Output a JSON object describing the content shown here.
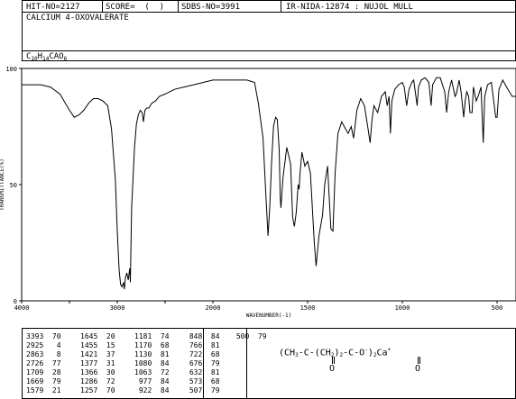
{
  "header": {
    "hit_no": "HIT-NO=2127",
    "score": "SCORE=  (  )",
    "sdbs_no": "SDBS-NO=3991",
    "ir_info": "IR-NIDA-12874 : NUJOL MULL",
    "compound_name": "CALCIUM 4-OXOVALERATE",
    "formula_parts": [
      "C",
      "10",
      "H",
      "14",
      "CAO",
      "6"
    ]
  },
  "chart_data": {
    "type": "line",
    "title": "",
    "xlabel": "WAVENUMBER(-1)",
    "ylabel": "TRANSMITTANCE(%)",
    "xlim": [
      4000,
      400
    ],
    "ylim": [
      0,
      100
    ],
    "x_ticks": [
      "4000",
      "3000",
      "2000",
      "1500",
      "1000",
      "500"
    ],
    "y_ticks": [
      "100",
      "50",
      "0"
    ],
    "series": [
      {
        "name": "",
        "points": [
          [
            4000,
            93
          ],
          [
            3800,
            93
          ],
          [
            3700,
            92
          ],
          [
            3600,
            89
          ],
          [
            3500,
            82
          ],
          [
            3450,
            79
          ],
          [
            3400,
            80
          ],
          [
            3350,
            82
          ],
          [
            3300,
            85
          ],
          [
            3250,
            87
          ],
          [
            3200,
            87
          ],
          [
            3150,
            86
          ],
          [
            3100,
            84
          ],
          [
            3060,
            74
          ],
          [
            3020,
            52
          ],
          [
            3000,
            30
          ],
          [
            2980,
            13
          ],
          [
            2965,
            7
          ],
          [
            2950,
            6
          ],
          [
            2935,
            8
          ],
          [
            2925,
            5
          ],
          [
            2915,
            10
          ],
          [
            2900,
            12
          ],
          [
            2885,
            9
          ],
          [
            2870,
            14
          ],
          [
            2863,
            8
          ],
          [
            2850,
            40
          ],
          [
            2820,
            66
          ],
          [
            2800,
            76
          ],
          [
            2780,
            80
          ],
          [
            2760,
            82
          ],
          [
            2740,
            81
          ],
          [
            2726,
            77
          ],
          [
            2710,
            82
          ],
          [
            2690,
            83
          ],
          [
            2670,
            83
          ],
          [
            2640,
            85
          ],
          [
            2600,
            86
          ],
          [
            2560,
            88
          ],
          [
            2500,
            89
          ],
          [
            2400,
            91
          ],
          [
            2300,
            92
          ],
          [
            2200,
            93
          ],
          [
            2100,
            94
          ],
          [
            2000,
            95
          ],
          [
            1900,
            95
          ],
          [
            1820,
            95
          ],
          [
            1780,
            94
          ],
          [
            1760,
            85
          ],
          [
            1735,
            70
          ],
          [
            1720,
            45
          ],
          [
            1709,
            28
          ],
          [
            1700,
            40
          ],
          [
            1690,
            60
          ],
          [
            1680,
            75
          ],
          [
            1669,
            79
          ],
          [
            1660,
            78
          ],
          [
            1650,
            65
          ],
          [
            1645,
            45
          ],
          [
            1641,
            40
          ],
          [
            1630,
            53
          ],
          [
            1610,
            66
          ],
          [
            1590,
            59
          ],
          [
            1579,
            36
          ],
          [
            1570,
            32
          ],
          [
            1560,
            38
          ],
          [
            1550,
            50
          ],
          [
            1545,
            48
          ],
          [
            1540,
            55
          ],
          [
            1530,
            64
          ],
          [
            1515,
            58
          ],
          [
            1500,
            60
          ],
          [
            1485,
            55
          ],
          [
            1465,
            25
          ],
          [
            1455,
            15
          ],
          [
            1440,
            28
          ],
          [
            1421,
            37
          ],
          [
            1410,
            50
          ],
          [
            1395,
            58
          ],
          [
            1377,
            31
          ],
          [
            1366,
            30
          ],
          [
            1355,
            55
          ],
          [
            1340,
            72
          ],
          [
            1320,
            77
          ],
          [
            1300,
            74
          ],
          [
            1286,
            72
          ],
          [
            1270,
            75
          ],
          [
            1257,
            70
          ],
          [
            1240,
            82
          ],
          [
            1220,
            87
          ],
          [
            1200,
            84
          ],
          [
            1181,
            74
          ],
          [
            1170,
            68
          ],
          [
            1160,
            78
          ],
          [
            1150,
            84
          ],
          [
            1130,
            81
          ],
          [
            1110,
            88
          ],
          [
            1090,
            90
          ],
          [
            1080,
            84
          ],
          [
            1070,
            88
          ],
          [
            1063,
            72
          ],
          [
            1055,
            86
          ],
          [
            1040,
            91
          ],
          [
            1020,
            93
          ],
          [
            1000,
            94
          ],
          [
            990,
            92
          ],
          [
            977,
            84
          ],
          [
            965,
            91
          ],
          [
            950,
            94
          ],
          [
            940,
            95
          ],
          [
            922,
            84
          ],
          [
            915,
            92
          ],
          [
            900,
            95
          ],
          [
            880,
            96
          ],
          [
            860,
            94
          ],
          [
            848,
            84
          ],
          [
            840,
            93
          ],
          [
            820,
            96
          ],
          [
            800,
            96
          ],
          [
            776,
            90
          ],
          [
            766,
            81
          ],
          [
            755,
            90
          ],
          [
            740,
            95
          ],
          [
            722,
            88
          ],
          [
            715,
            89
          ],
          [
            700,
            95
          ],
          [
            690,
            90
          ],
          [
            676,
            79
          ],
          [
            668,
            86
          ],
          [
            660,
            90
          ],
          [
            650,
            88
          ],
          [
            643,
            81
          ],
          [
            632,
            81
          ],
          [
            625,
            92
          ],
          [
            610,
            86
          ],
          [
            600,
            88
          ],
          [
            585,
            92
          ],
          [
            573,
            68
          ],
          [
            565,
            88
          ],
          [
            550,
            93
          ],
          [
            530,
            94
          ],
          [
            507,
            79
          ],
          [
            500,
            79
          ],
          [
            490,
            91
          ],
          [
            470,
            95
          ],
          [
            450,
            92
          ],
          [
            420,
            88
          ],
          [
            400,
            88
          ]
        ]
      }
    ],
    "peaks": [
      {
        "wavenumber": "3393",
        "transmittance": "70"
      },
      {
        "wavenumber": "2925",
        "transmittance": "4"
      },
      {
        "wavenumber": "2863",
        "transmittance": "8"
      },
      {
        "wavenumber": "2726",
        "transmittance": "77"
      },
      {
        "wavenumber": "1709",
        "transmittance": "28"
      },
      {
        "wavenumber": "1669",
        "transmittance": "79"
      },
      {
        "wavenumber": "1579",
        "transmittance": "21"
      },
      {
        "wavenumber": "1645",
        "transmittance": "20"
      },
      {
        "wavenumber": "1455",
        "transmittance": "15"
      },
      {
        "wavenumber": "1421",
        "transmittance": "37"
      },
      {
        "wavenumber": "1377",
        "transmittance": "31"
      },
      {
        "wavenumber": "1366",
        "transmittance": "30"
      },
      {
        "wavenumber": "1286",
        "transmittance": "72"
      },
      {
        "wavenumber": "1257",
        "transmittance": "70"
      },
      {
        "wavenumber": "1181",
        "transmittance": "74"
      },
      {
        "wavenumber": "1170",
        "transmittance": "68"
      },
      {
        "wavenumber": "1130",
        "transmittance": "81"
      },
      {
        "wavenumber": "1080",
        "transmittance": "84"
      },
      {
        "wavenumber": "1063",
        "transmittance": "72"
      },
      {
        "wavenumber": "977",
        "transmittance": "84"
      },
      {
        "wavenumber": "922",
        "transmittance": "84"
      },
      {
        "wavenumber": "848",
        "transmittance": "84"
      },
      {
        "wavenumber": "766",
        "transmittance": "81"
      },
      {
        "wavenumber": "722",
        "transmittance": "68"
      },
      {
        "wavenumber": "676",
        "transmittance": "79"
      },
      {
        "wavenumber": "632",
        "transmittance": "81"
      },
      {
        "wavenumber": "573",
        "transmittance": "68"
      },
      {
        "wavenumber": "507",
        "transmittance": "79"
      },
      {
        "wavenumber": "500",
        "transmittance": "79"
      }
    ]
  },
  "structure": {
    "line1_prefix": "(CH",
    "sub3": "3",
    "dash1": "-C-",
    "paren2": "(CH",
    "sub2a": "2",
    "close2": ")",
    "sub2b": "2",
    "dash2": "-C-O",
    "superminus": "-",
    "close3": ")",
    "sub2c": "2",
    "ca": "Ca",
    "superplus": "+",
    "oxygen1": "O",
    "oxygen2": "O"
  }
}
